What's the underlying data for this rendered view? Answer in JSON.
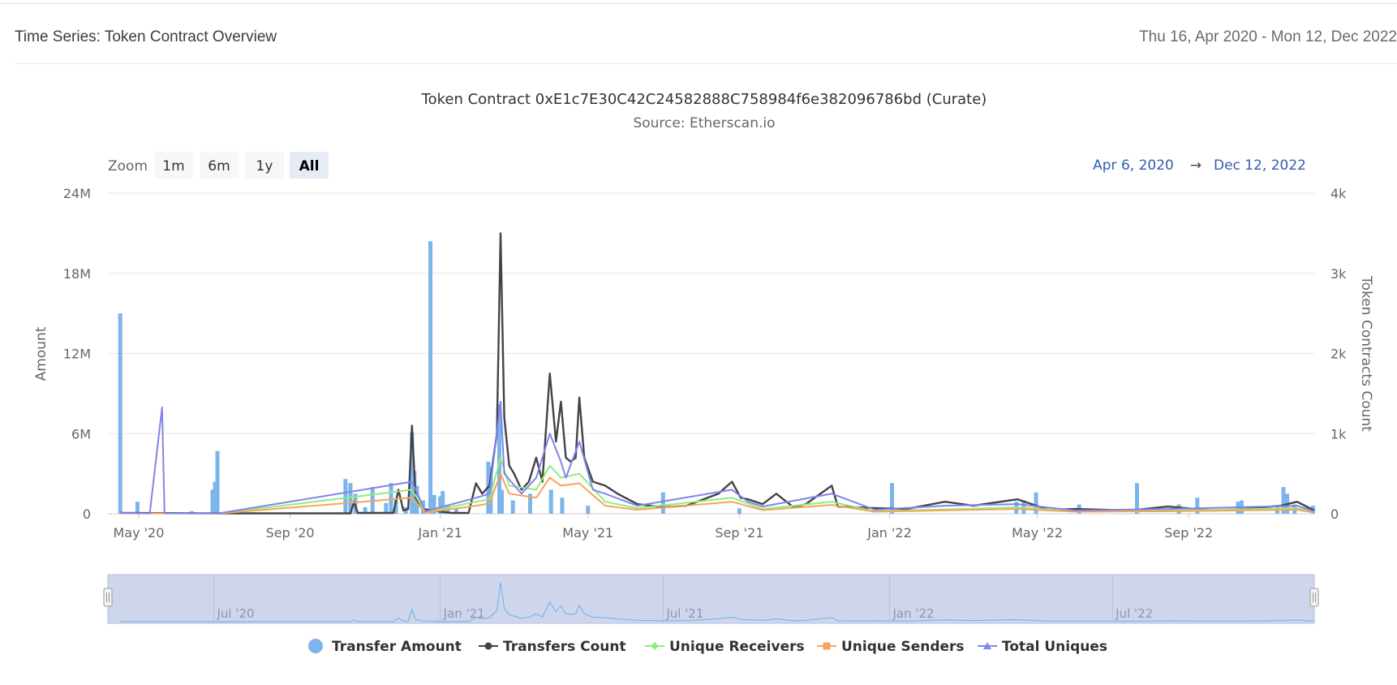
{
  "header": {
    "title": "Time Series: Token Contract Overview",
    "date_range": "Thu 16, Apr 2020 - Mon 12, Dec 2022"
  },
  "chart": {
    "title": "Token Contract 0xE1c7E30C42C24582888C758984f6e382096786bd (Curate)",
    "subtitle": "Source: Etherscan.io",
    "zoom_label": "Zoom",
    "zoom_buttons": [
      "1m",
      "6m",
      "1y",
      "All"
    ],
    "zoom_selected": "All",
    "range_from": "Apr 6, 2020",
    "range_arrow": "→",
    "range_to": "Dec 12, 2022",
    "navigator_labels": [
      "Jul '20",
      "Jan '21",
      "Jul '21",
      "Jan '22",
      "Jul '22"
    ]
  },
  "legend": [
    {
      "label": "Transfer Amount",
      "color": "#7cb5ec",
      "symbol": "circle"
    },
    {
      "label": "Transfers Count",
      "color": "#434348",
      "symbol": "circle-line"
    },
    {
      "label": "Unique Receivers",
      "color": "#90ed7d",
      "symbol": "diamond-line"
    },
    {
      "label": "Unique Senders",
      "color": "#f7a35c",
      "symbol": "square-line"
    },
    {
      "label": "Total Uniques",
      "color": "#8085e9",
      "symbol": "triangle-line"
    }
  ],
  "chart_data": {
    "type": "bar+line",
    "x_axis": {
      "type": "datetime",
      "range": [
        "2020-04-06",
        "2022-12-12"
      ],
      "tick_labels": [
        "May '20",
        "Sep '20",
        "Jan '21",
        "May '21",
        "Sep '21",
        "Jan '22",
        "May '22",
        "Sep '22"
      ]
    },
    "y_left": {
      "label": "Amount",
      "range": [
        0,
        24000000
      ],
      "tick_labels": [
        "0",
        "6M",
        "12M",
        "18M",
        "24M"
      ]
    },
    "y_right": {
      "label": "Token Contracts Count",
      "range": [
        0,
        4000
      ],
      "tick_labels": [
        "0",
        "1k",
        "2k",
        "3k",
        "4k"
      ]
    },
    "grid": true,
    "legend_placement": "bottom",
    "series": [
      {
        "name": "Transfer Amount",
        "axis": "left",
        "type": "column",
        "points": [
          [
            "2020-04-16",
            15000000
          ],
          [
            "2020-04-30",
            900000
          ],
          [
            "2020-06-13",
            200000
          ],
          [
            "2020-06-30",
            1800000
          ],
          [
            "2020-07-02",
            2400000
          ],
          [
            "2020-07-04",
            4700000
          ],
          [
            "2020-10-16",
            2600000
          ],
          [
            "2020-10-20",
            2300000
          ],
          [
            "2020-10-24",
            1500000
          ],
          [
            "2020-11-01",
            500000
          ],
          [
            "2020-11-07",
            2000000
          ],
          [
            "2020-11-18",
            800000
          ],
          [
            "2020-11-22",
            2300000
          ],
          [
            "2020-11-26",
            1000000
          ],
          [
            "2020-12-04",
            500000
          ],
          [
            "2020-12-09",
            6100000
          ],
          [
            "2020-12-11",
            3200000
          ],
          [
            "2020-12-13",
            2100000
          ],
          [
            "2020-12-18",
            1000000
          ],
          [
            "2020-12-24",
            20400000
          ],
          [
            "2020-12-27",
            1400000
          ],
          [
            "2021-01-01",
            1300000
          ],
          [
            "2021-01-03",
            1700000
          ],
          [
            "2021-01-07",
            600000
          ],
          [
            "2021-01-14",
            400000
          ],
          [
            "2021-02-09",
            3900000
          ],
          [
            "2021-02-11",
            3500000
          ],
          [
            "2021-02-18",
            8200000
          ],
          [
            "2021-02-20",
            1800000
          ],
          [
            "2021-03-01",
            1000000
          ],
          [
            "2021-03-15",
            1500000
          ],
          [
            "2021-04-01",
            1800000
          ],
          [
            "2021-04-10",
            1200000
          ],
          [
            "2021-05-01",
            600000
          ],
          [
            "2021-07-01",
            1600000
          ],
          [
            "2021-09-01",
            400000
          ],
          [
            "2022-01-03",
            2300000
          ],
          [
            "2022-04-14",
            900000
          ],
          [
            "2022-04-20",
            1000000
          ],
          [
            "2022-04-30",
            1600000
          ],
          [
            "2022-06-04",
            700000
          ],
          [
            "2022-07-21",
            2300000
          ],
          [
            "2022-08-24",
            700000
          ],
          [
            "2022-09-08",
            1200000
          ],
          [
            "2022-10-11",
            900000
          ],
          [
            "2022-10-14",
            1000000
          ],
          [
            "2022-11-12",
            600000
          ],
          [
            "2022-11-17",
            2000000
          ],
          [
            "2022-11-20",
            1500000
          ],
          [
            "2022-11-26",
            700000
          ],
          [
            "2022-12-11",
            600000
          ]
        ]
      },
      {
        "name": "Transfers Count",
        "axis": "right",
        "type": "line",
        "points": [
          [
            "2020-04-16",
            10
          ],
          [
            "2020-07-05",
            5
          ],
          [
            "2020-10-20",
            5
          ],
          [
            "2020-10-23",
            150
          ],
          [
            "2020-10-26",
            10
          ],
          [
            "2020-11-24",
            10
          ],
          [
            "2020-11-28",
            300
          ],
          [
            "2020-12-02",
            40
          ],
          [
            "2020-12-06",
            60
          ],
          [
            "2020-12-09",
            1100
          ],
          [
            "2020-12-12",
            200
          ],
          [
            "2020-12-18",
            60
          ],
          [
            "2020-12-30",
            30
          ],
          [
            "2021-01-10",
            10
          ],
          [
            "2021-01-24",
            10
          ],
          [
            "2021-01-30",
            380
          ],
          [
            "2021-02-04",
            250
          ],
          [
            "2021-02-10",
            350
          ],
          [
            "2021-02-16",
            1000
          ],
          [
            "2021-02-19",
            3500
          ],
          [
            "2021-02-22",
            1200
          ],
          [
            "2021-02-26",
            600
          ],
          [
            "2021-03-02",
            500
          ],
          [
            "2021-03-08",
            300
          ],
          [
            "2021-03-14",
            400
          ],
          [
            "2021-03-20",
            700
          ],
          [
            "2021-03-25",
            400
          ],
          [
            "2021-03-31",
            1750
          ],
          [
            "2021-04-05",
            900
          ],
          [
            "2021-04-09",
            1400
          ],
          [
            "2021-04-13",
            700
          ],
          [
            "2021-04-17",
            650
          ],
          [
            "2021-04-21",
            700
          ],
          [
            "2021-04-24",
            1450
          ],
          [
            "2021-04-28",
            700
          ],
          [
            "2021-05-05",
            400
          ],
          [
            "2021-05-15",
            350
          ],
          [
            "2021-05-25",
            250
          ],
          [
            "2021-06-10",
            120
          ],
          [
            "2021-07-01",
            80
          ],
          [
            "2021-07-20",
            100
          ],
          [
            "2021-08-15",
            250
          ],
          [
            "2021-08-26",
            400
          ],
          [
            "2021-09-02",
            200
          ],
          [
            "2021-09-08",
            180
          ],
          [
            "2021-09-20",
            120
          ],
          [
            "2021-10-01",
            250
          ],
          [
            "2021-10-15",
            80
          ],
          [
            "2021-10-25",
            120
          ],
          [
            "2021-11-15",
            350
          ],
          [
            "2021-11-20",
            90
          ],
          [
            "2021-12-20",
            70
          ],
          [
            "2022-01-15",
            60
          ],
          [
            "2022-02-15",
            150
          ],
          [
            "2022-03-10",
            100
          ],
          [
            "2022-04-15",
            180
          ],
          [
            "2022-05-10",
            50
          ],
          [
            "2022-06-01",
            60
          ],
          [
            "2022-07-15",
            40
          ],
          [
            "2022-08-15",
            90
          ],
          [
            "2022-09-20",
            40
          ],
          [
            "2022-10-15",
            60
          ],
          [
            "2022-11-15",
            100
          ],
          [
            "2022-11-28",
            150
          ],
          [
            "2022-12-12",
            40
          ]
        ]
      },
      {
        "name": "Unique Receivers",
        "axis": "right",
        "type": "line",
        "points": [
          [
            "2020-04-16",
            5
          ],
          [
            "2020-07-05",
            3
          ],
          [
            "2020-12-09",
            300
          ],
          [
            "2020-12-20",
            20
          ],
          [
            "2021-01-30",
            150
          ],
          [
            "2021-02-10",
            180
          ],
          [
            "2021-02-19",
            700
          ],
          [
            "2021-02-26",
            350
          ],
          [
            "2021-03-20",
            300
          ],
          [
            "2021-03-31",
            600
          ],
          [
            "2021-04-09",
            450
          ],
          [
            "2021-04-24",
            500
          ],
          [
            "2021-05-15",
            150
          ],
          [
            "2021-06-10",
            70
          ],
          [
            "2021-08-26",
            200
          ],
          [
            "2021-09-20",
            60
          ],
          [
            "2021-11-15",
            150
          ],
          [
            "2021-12-20",
            30
          ],
          [
            "2022-04-15",
            80
          ],
          [
            "2022-06-01",
            30
          ],
          [
            "2022-08-15",
            40
          ],
          [
            "2022-11-28",
            70
          ],
          [
            "2022-12-12",
            20
          ]
        ]
      },
      {
        "name": "Unique Senders",
        "axis": "right",
        "type": "line",
        "points": [
          [
            "2020-04-16",
            5
          ],
          [
            "2020-07-05",
            3
          ],
          [
            "2020-12-09",
            200
          ],
          [
            "2020-12-20",
            15
          ],
          [
            "2021-01-30",
            100
          ],
          [
            "2021-02-10",
            130
          ],
          [
            "2021-02-19",
            500
          ],
          [
            "2021-02-26",
            250
          ],
          [
            "2021-03-20",
            200
          ],
          [
            "2021-03-31",
            450
          ],
          [
            "2021-04-09",
            350
          ],
          [
            "2021-04-24",
            380
          ],
          [
            "2021-05-15",
            100
          ],
          [
            "2021-06-10",
            50
          ],
          [
            "2021-08-26",
            150
          ],
          [
            "2021-09-20",
            45
          ],
          [
            "2021-11-15",
            110
          ],
          [
            "2021-12-20",
            25
          ],
          [
            "2022-04-15",
            60
          ],
          [
            "2022-06-01",
            25
          ],
          [
            "2022-08-15",
            30
          ],
          [
            "2022-11-28",
            50
          ],
          [
            "2022-12-12",
            15
          ]
        ]
      },
      {
        "name": "Total Uniques",
        "axis": "right",
        "type": "line",
        "points": [
          [
            "2020-04-16",
            10
          ],
          [
            "2020-05-10",
            5
          ],
          [
            "2020-05-20",
            1330
          ],
          [
            "2020-05-22",
            5
          ],
          [
            "2020-07-05",
            5
          ],
          [
            "2020-12-09",
            400
          ],
          [
            "2020-12-20",
            30
          ],
          [
            "2021-01-30",
            200
          ],
          [
            "2021-02-10",
            250
          ],
          [
            "2021-02-19",
            1400
          ],
          [
            "2021-02-22",
            500
          ],
          [
            "2021-03-08",
            250
          ],
          [
            "2021-03-20",
            450
          ],
          [
            "2021-03-31",
            1000
          ],
          [
            "2021-04-09",
            650
          ],
          [
            "2021-04-13",
            450
          ],
          [
            "2021-04-24",
            900
          ],
          [
            "2021-05-05",
            300
          ],
          [
            "2021-05-15",
            250
          ],
          [
            "2021-06-10",
            100
          ],
          [
            "2021-08-26",
            300
          ],
          [
            "2021-09-08",
            150
          ],
          [
            "2021-09-20",
            90
          ],
          [
            "2021-11-15",
            250
          ],
          [
            "2021-12-20",
            50
          ],
          [
            "2022-02-15",
            100
          ],
          [
            "2022-04-15",
            120
          ],
          [
            "2022-06-01",
            40
          ],
          [
            "2022-08-15",
            60
          ],
          [
            "2022-11-28",
            100
          ],
          [
            "2022-12-12",
            30
          ]
        ]
      }
    ]
  }
}
